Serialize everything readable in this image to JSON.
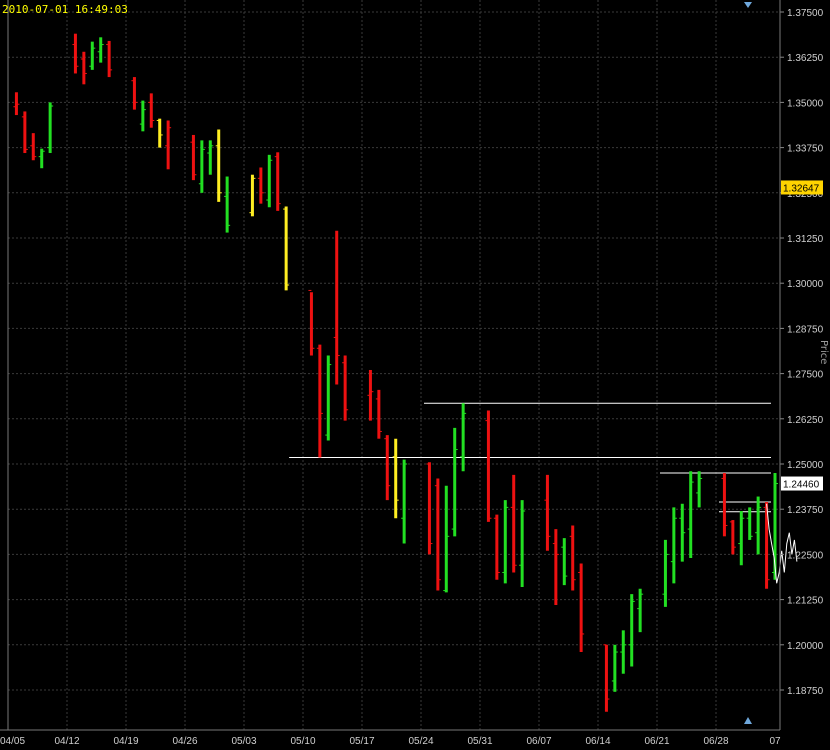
{
  "timestamp": "2010-07-01 16:49:03",
  "axis_side_label": "Price",
  "chart_data": {
    "type": "ohlc",
    "colors": {
      "up": "#22e022",
      "down": "#ee1111",
      "neutral": "#ffee22",
      "background": "#000000",
      "grid": "#3a3a3a",
      "axis_text": "#d0d0d0"
    },
    "ylim": [
      1.1815,
      1.375
    ],
    "yticks": [
      1.375,
      1.3625,
      1.35,
      1.3375,
      1.325,
      1.3125,
      1.3,
      1.2875,
      1.275,
      1.2625,
      1.25,
      1.2375,
      1.225,
      1.2125,
      1.2,
      1.1875
    ],
    "ytick_labels": [
      "1.37500",
      "1.36250",
      "1.35000",
      "1.33750",
      "1.32500",
      "1.31250",
      "1.30000",
      "1.28750",
      "1.27500",
      "1.26250",
      "1.25000",
      "1.23750",
      "1.22500",
      "1.21250",
      "1.20000",
      "1.18750"
    ],
    "xtick_labels": [
      "04/05",
      "04/12",
      "04/19",
      "04/26",
      "05/03",
      "05/10",
      "05/17",
      "05/24",
      "05/31",
      "06/07",
      "06/14",
      "06/21",
      "06/28",
      "07"
    ],
    "xtick_days": [
      0,
      7,
      14,
      21,
      28,
      35,
      42,
      49,
      56,
      63,
      70,
      77,
      84,
      91
    ],
    "price_tags": [
      {
        "value": 1.32647,
        "label": "1.32647",
        "bg": "#ffd400",
        "fg": "#000000"
      },
      {
        "value": 1.2446,
        "label": "1.24460",
        "bg": "#ffffff",
        "fg": "#000000"
      }
    ],
    "levels": [
      {
        "y": 1.2668,
        "from_day": 49,
        "to_day": 91
      },
      {
        "y": 1.2518,
        "from_day": 33,
        "to_day": 91
      },
      {
        "y": 1.2475,
        "from_day": 77,
        "to_day": 91
      },
      {
        "y": 1.2395,
        "from_day": 84,
        "to_day": 91
      },
      {
        "y": 1.2368,
        "from_day": 84,
        "to_day": 91
      }
    ],
    "bars": [
      {
        "d": 1,
        "o": 1.3488,
        "h": 1.3528,
        "l": 1.3465,
        "c": 1.3495,
        "k": "down"
      },
      {
        "d": 2,
        "o": 1.346,
        "h": 1.3475,
        "l": 1.336,
        "c": 1.337,
        "k": "down"
      },
      {
        "d": 3,
        "o": 1.338,
        "h": 1.3415,
        "l": 1.334,
        "c": 1.335,
        "k": "down"
      },
      {
        "d": 4,
        "o": 1.335,
        "h": 1.3372,
        "l": 1.3318,
        "c": 1.3365,
        "k": "up"
      },
      {
        "d": 5,
        "o": 1.3375,
        "h": 1.35,
        "l": 1.336,
        "c": 1.349,
        "k": "up"
      },
      {
        "d": 8,
        "o": 1.366,
        "h": 1.369,
        "l": 1.358,
        "c": 1.36,
        "k": "down"
      },
      {
        "d": 9,
        "o": 1.362,
        "h": 1.364,
        "l": 1.355,
        "c": 1.358,
        "k": "down"
      },
      {
        "d": 10,
        "o": 1.36,
        "h": 1.3668,
        "l": 1.359,
        "c": 1.365,
        "k": "up"
      },
      {
        "d": 11,
        "o": 1.364,
        "h": 1.368,
        "l": 1.361,
        "c": 1.366,
        "k": "up"
      },
      {
        "d": 12,
        "o": 1.366,
        "h": 1.367,
        "l": 1.357,
        "c": 1.359,
        "k": "down"
      },
      {
        "d": 15,
        "o": 1.356,
        "h": 1.357,
        "l": 1.348,
        "c": 1.35,
        "k": "down"
      },
      {
        "d": 16,
        "o": 1.344,
        "h": 1.3505,
        "l": 1.342,
        "c": 1.348,
        "k": "up"
      },
      {
        "d": 17,
        "o": 1.35,
        "h": 1.3525,
        "l": 1.343,
        "c": 1.345,
        "k": "down"
      },
      {
        "d": 18,
        "o": 1.345,
        "h": 1.3455,
        "l": 1.3375,
        "c": 1.341,
        "k": "neutral"
      },
      {
        "d": 19,
        "o": 1.338,
        "h": 1.345,
        "l": 1.3315,
        "c": 1.343,
        "k": "down"
      },
      {
        "d": 22,
        "o": 1.339,
        "h": 1.341,
        "l": 1.3285,
        "c": 1.33,
        "k": "down"
      },
      {
        "d": 23,
        "o": 1.3275,
        "h": 1.3395,
        "l": 1.325,
        "c": 1.337,
        "k": "up"
      },
      {
        "d": 24,
        "o": 1.336,
        "h": 1.3395,
        "l": 1.33,
        "c": 1.338,
        "k": "up"
      },
      {
        "d": 25,
        "o": 1.338,
        "h": 1.3425,
        "l": 1.3225,
        "c": 1.325,
        "k": "neutral"
      },
      {
        "d": 26,
        "o": 1.324,
        "h": 1.3295,
        "l": 1.314,
        "c": 1.316,
        "k": "up"
      },
      {
        "d": 29,
        "o": 1.3195,
        "h": 1.33,
        "l": 1.3185,
        "c": 1.329,
        "k": "neutral"
      },
      {
        "d": 30,
        "o": 1.329,
        "h": 1.332,
        "l": 1.322,
        "c": 1.325,
        "k": "down"
      },
      {
        "d": 31,
        "o": 1.323,
        "h": 1.3355,
        "l": 1.321,
        "c": 1.334,
        "k": "up"
      },
      {
        "d": 32,
        "o": 1.335,
        "h": 1.3362,
        "l": 1.32,
        "c": 1.322,
        "k": "down"
      },
      {
        "d": 33,
        "o": 1.3205,
        "h": 1.3212,
        "l": 1.298,
        "c": 1.2995,
        "k": "neutral"
      },
      {
        "d": 36,
        "o": 1.298,
        "h": 1.2975,
        "l": 1.28,
        "c": 1.282,
        "k": "down"
      },
      {
        "d": 37,
        "o": 1.282,
        "h": 1.283,
        "l": 1.2518,
        "c": 1.264,
        "k": "down"
      },
      {
        "d": 38,
        "o": 1.258,
        "h": 1.28,
        "l": 1.2565,
        "c": 1.2775,
        "k": "up"
      },
      {
        "d": 39,
        "o": 1.285,
        "h": 1.3145,
        "l": 1.272,
        "c": 1.28,
        "k": "down"
      },
      {
        "d": 40,
        "o": 1.278,
        "h": 1.28,
        "l": 1.262,
        "c": 1.265,
        "k": "down"
      },
      {
        "d": 43,
        "o": 1.269,
        "h": 1.276,
        "l": 1.262,
        "c": 1.27,
        "k": "down"
      },
      {
        "d": 44,
        "o": 1.268,
        "h": 1.2705,
        "l": 1.257,
        "c": 1.259,
        "k": "down"
      },
      {
        "d": 45,
        "o": 1.257,
        "h": 1.258,
        "l": 1.24,
        "c": 1.244,
        "k": "down"
      },
      {
        "d": 46,
        "o": 1.252,
        "h": 1.257,
        "l": 1.235,
        "c": 1.24,
        "k": "neutral"
      },
      {
        "d": 47,
        "o": 1.235,
        "h": 1.2512,
        "l": 1.228,
        "c": 1.25,
        "k": "up"
      },
      {
        "d": 50,
        "o": 1.25,
        "h": 1.2505,
        "l": 1.225,
        "c": 1.228,
        "k": "down"
      },
      {
        "d": 51,
        "o": 1.244,
        "h": 1.246,
        "l": 1.215,
        "c": 1.218,
        "k": "down"
      },
      {
        "d": 52,
        "o": 1.215,
        "h": 1.244,
        "l": 1.2145,
        "c": 1.23,
        "k": "up"
      },
      {
        "d": 53,
        "o": 1.232,
        "h": 1.26,
        "l": 1.23,
        "c": 1.254,
        "k": "up"
      },
      {
        "d": 54,
        "o": 1.252,
        "h": 1.2668,
        "l": 1.248,
        "c": 1.264,
        "k": "up"
      },
      {
        "d": 57,
        "o": 1.262,
        "h": 1.2648,
        "l": 1.234,
        "c": 1.235,
        "k": "down"
      },
      {
        "d": 58,
        "o": 1.235,
        "h": 1.236,
        "l": 1.218,
        "c": 1.22,
        "k": "down"
      },
      {
        "d": 59,
        "o": 1.22,
        "h": 1.24,
        "l": 1.217,
        "c": 1.238,
        "k": "up"
      },
      {
        "d": 60,
        "o": 1.238,
        "h": 1.247,
        "l": 1.22,
        "c": 1.222,
        "k": "down"
      },
      {
        "d": 61,
        "o": 1.222,
        "h": 1.24,
        "l": 1.216,
        "c": 1.237,
        "k": "up"
      },
      {
        "d": 64,
        "o": 1.24,
        "h": 1.247,
        "l": 1.226,
        "c": 1.23,
        "k": "down"
      },
      {
        "d": 65,
        "o": 1.228,
        "h": 1.232,
        "l": 1.211,
        "c": 1.225,
        "k": "down"
      },
      {
        "d": 66,
        "o": 1.227,
        "h": 1.2295,
        "l": 1.2165,
        "c": 1.219,
        "k": "up"
      },
      {
        "d": 67,
        "o": 1.23,
        "h": 1.233,
        "l": 1.215,
        "c": 1.218,
        "k": "down"
      },
      {
        "d": 68,
        "o": 1.22,
        "h": 1.2225,
        "l": 1.198,
        "c": 1.203,
        "k": "down"
      },
      {
        "d": 71,
        "o": 1.2,
        "h": 1.2,
        "l": 1.1815,
        "c": 1.185,
        "k": "down"
      },
      {
        "d": 72,
        "o": 1.19,
        "h": 1.2,
        "l": 1.187,
        "c": 1.198,
        "k": "up"
      },
      {
        "d": 73,
        "o": 1.198,
        "h": 1.204,
        "l": 1.192,
        "c": 1.2,
        "k": "up"
      },
      {
        "d": 74,
        "o": 1.2,
        "h": 1.214,
        "l": 1.194,
        "c": 1.212,
        "k": "up"
      },
      {
        "d": 75,
        "o": 1.21,
        "h": 1.2155,
        "l": 1.2035,
        "c": 1.214,
        "k": "up"
      },
      {
        "d": 78,
        "o": 1.214,
        "h": 1.229,
        "l": 1.2105,
        "c": 1.225,
        "k": "up"
      },
      {
        "d": 79,
        "o": 1.223,
        "h": 1.238,
        "l": 1.217,
        "c": 1.235,
        "k": "up"
      },
      {
        "d": 80,
        "o": 1.235,
        "h": 1.239,
        "l": 1.223,
        "c": 1.231,
        "k": "up"
      },
      {
        "d": 81,
        "o": 1.232,
        "h": 1.248,
        "l": 1.224,
        "c": 1.245,
        "k": "up"
      },
      {
        "d": 82,
        "o": 1.242,
        "h": 1.248,
        "l": 1.238,
        "c": 1.246,
        "k": "up"
      },
      {
        "d": 85,
        "o": 1.246,
        "h": 1.2475,
        "l": 1.23,
        "c": 1.233,
        "k": "down"
      },
      {
        "d": 86,
        "o": 1.234,
        "h": 1.2345,
        "l": 1.225,
        "c": 1.227,
        "k": "down"
      },
      {
        "d": 87,
        "o": 1.228,
        "h": 1.237,
        "l": 1.222,
        "c": 1.235,
        "k": "up"
      },
      {
        "d": 88,
        "o": 1.235,
        "h": 1.238,
        "l": 1.229,
        "c": 1.23,
        "k": "up"
      },
      {
        "d": 89,
        "o": 1.231,
        "h": 1.241,
        "l": 1.225,
        "c": 1.238,
        "k": "up"
      },
      {
        "d": 90,
        "o": 1.238,
        "h": 1.2395,
        "l": 1.2155,
        "c": 1.218,
        "k": "down"
      },
      {
        "d": 91,
        "o": 1.22,
        "h": 1.2475,
        "l": 1.218,
        "c": 1.2446,
        "k": "up"
      }
    ],
    "intraday": [
      [
        90.0,
        1.239
      ],
      [
        90.3,
        1.232
      ],
      [
        90.6,
        1.228
      ],
      [
        90.9,
        1.224
      ],
      [
        91.2,
        1.217
      ],
      [
        91.5,
        1.22
      ],
      [
        91.8,
        1.226
      ],
      [
        92.1,
        1.22
      ],
      [
        92.4,
        1.228
      ],
      [
        92.7,
        1.231
      ],
      [
        93.0,
        1.225
      ],
      [
        93.3,
        1.229
      ],
      [
        93.6,
        1.223
      ]
    ]
  }
}
